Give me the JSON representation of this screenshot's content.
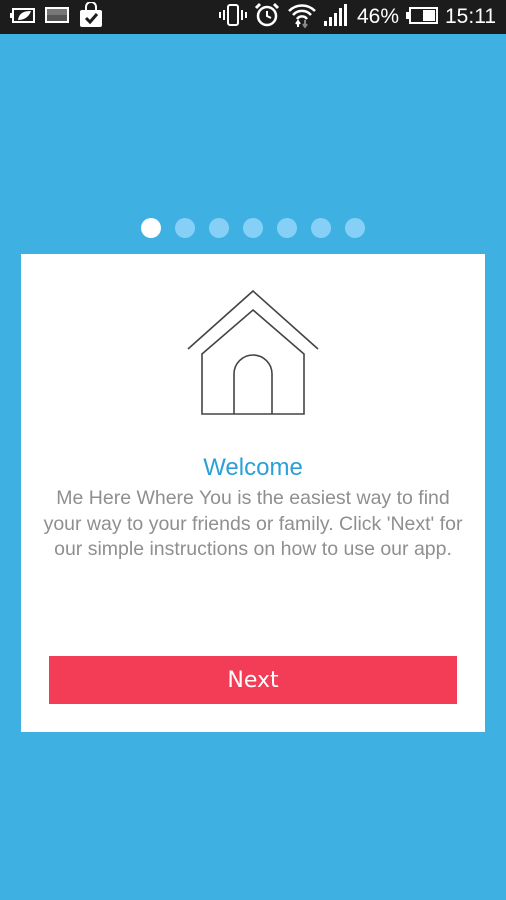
{
  "status_bar": {
    "left_icons": [
      "battery-saver-icon",
      "image-icon",
      "shopping-bag-check-icon"
    ],
    "right_icons": [
      "vibrate-icon",
      "alarm-icon",
      "wifi-icon",
      "signal-icon"
    ],
    "battery_percent": "46%",
    "battery_level": 0.46,
    "time": "15:11"
  },
  "pager": {
    "total": 7,
    "active_index": 0
  },
  "card": {
    "icon": "house-icon",
    "title": "Welcome",
    "description": "Me Here Where You is the easiest way to find your way to your friends or family. Click 'Next' for our simple instructions on how to use our app.",
    "next_label": "Next"
  },
  "colors": {
    "background": "#3fb0e2",
    "title": "#2aa0d6",
    "button": "#f33d56",
    "dot_active": "#ffffff",
    "dot_inactive": "#86d0f7"
  }
}
